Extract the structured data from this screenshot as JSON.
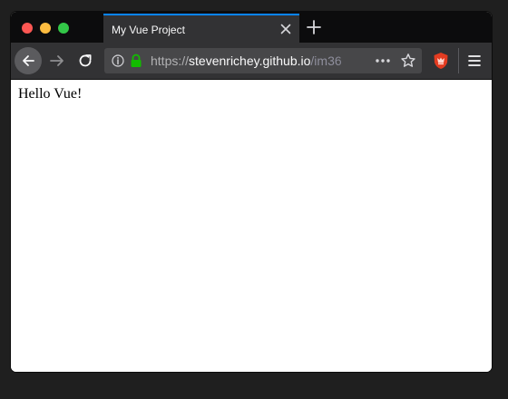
{
  "window": {
    "traffic_lights": {
      "close_color": "#fc5753",
      "minimize_color": "#fdbc40",
      "maximize_color": "#33c748"
    }
  },
  "tabs": [
    {
      "title": "My Vue Project",
      "active": true,
      "close_icon": "close-icon"
    }
  ],
  "toolbar": {
    "new_tab_icon": "plus-icon",
    "back_icon": "arrow-left-icon",
    "forward_icon": "arrow-right-icon",
    "reload_icon": "reload-icon",
    "extension_icon": "extension-icon",
    "menu_icon": "hamburger-menu-icon"
  },
  "urlbar": {
    "scheme": "https://",
    "host": "stevenrichey.github.io",
    "path": "/im36",
    "info_icon": "info-icon",
    "lock_icon": "lock-icon",
    "lock_color": "#12bc00",
    "more_icon": "ellipsis-icon",
    "bookmark_icon": "star-icon"
  },
  "page": {
    "text": "Hello Vue!"
  },
  "colors": {
    "accent": "#0a84ff",
    "tabbar_bg": "#0c0c0d",
    "toolbar_bg": "#323234",
    "urlbar_bg": "#474749"
  }
}
